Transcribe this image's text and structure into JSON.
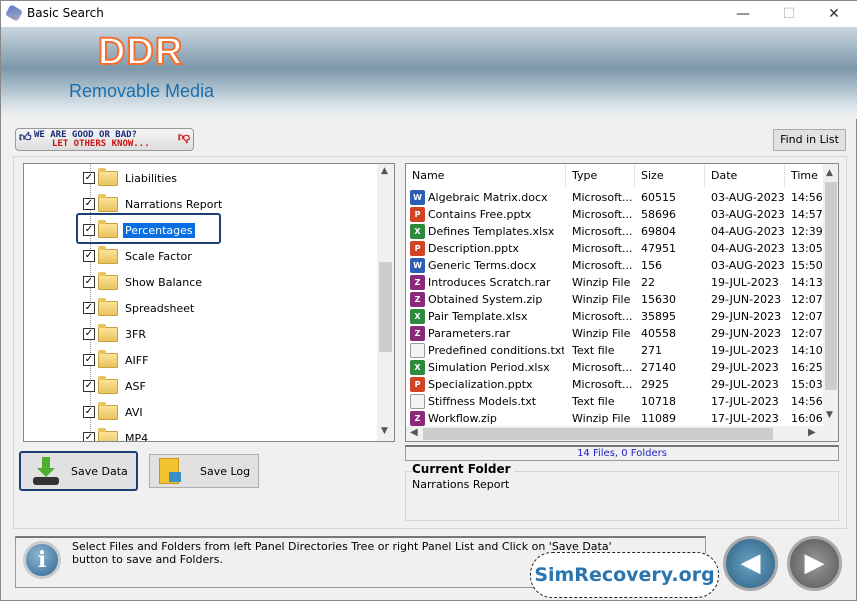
{
  "window": {
    "title": "Basic Search",
    "minimize": "—",
    "maximize": "☐",
    "close": "✕"
  },
  "banner": {
    "logo": "DDR",
    "subtitle": "Removable Media"
  },
  "feedback": {
    "line1": "WE ARE GOOD OR BAD?",
    "line2": "LET OTHERS KNOW..."
  },
  "toolbar": {
    "find_label": "Find in List"
  },
  "tree": {
    "items": [
      {
        "label": "Liabilities",
        "checked": true,
        "selected": false
      },
      {
        "label": "Narrations Report",
        "checked": true,
        "selected": false
      },
      {
        "label": "Percentages",
        "checked": true,
        "selected": true
      },
      {
        "label": "Scale Factor",
        "checked": true,
        "selected": false
      },
      {
        "label": "Show Balance",
        "checked": true,
        "selected": false
      },
      {
        "label": "Spreadsheet",
        "checked": true,
        "selected": false
      },
      {
        "label": "3FR",
        "checked": true,
        "selected": false
      },
      {
        "label": "AIFF",
        "checked": true,
        "selected": false
      },
      {
        "label": "ASF",
        "checked": true,
        "selected": false
      },
      {
        "label": "AVI",
        "checked": true,
        "selected": false
      },
      {
        "label": "MP4",
        "checked": true,
        "selected": false
      }
    ]
  },
  "list": {
    "columns": [
      "Name",
      "Type",
      "Size",
      "Date",
      "Time"
    ],
    "rows": [
      {
        "icon": "word",
        "name": "Algebraic Matrix.docx",
        "type": "Microsoft...",
        "size": "60515",
        "date": "03-AUG-2023",
        "time": "14:56"
      },
      {
        "icon": "powerpoint",
        "name": "Contains Free.pptx",
        "type": "Microsoft...",
        "size": "58696",
        "date": "03-AUG-2023",
        "time": "14:57"
      },
      {
        "icon": "excel",
        "name": "Defines Templates.xlsx",
        "type": "Microsoft...",
        "size": "69804",
        "date": "04-AUG-2023",
        "time": "12:39"
      },
      {
        "icon": "powerpoint",
        "name": "Description.pptx",
        "type": "Microsoft...",
        "size": "47951",
        "date": "04-AUG-2023",
        "time": "13:05"
      },
      {
        "icon": "word",
        "name": "Generic Terms.docx",
        "type": "Microsoft...",
        "size": "156",
        "date": "03-AUG-2023",
        "time": "15:50"
      },
      {
        "icon": "archive",
        "name": "Introduces Scratch.rar",
        "type": "Winzip File",
        "size": "22",
        "date": "19-JUL-2023",
        "time": "14:13"
      },
      {
        "icon": "archive",
        "name": "Obtained System.zip",
        "type": "Winzip File",
        "size": "15630",
        "date": "29-JUN-2023",
        "time": "12:07"
      },
      {
        "icon": "excel",
        "name": "Pair Template.xlsx",
        "type": "Microsoft...",
        "size": "35895",
        "date": "29-JUN-2023",
        "time": "12:07"
      },
      {
        "icon": "archive",
        "name": "Parameters.rar",
        "type": "Winzip File",
        "size": "40558",
        "date": "29-JUN-2023",
        "time": "12:07"
      },
      {
        "icon": "text",
        "name": "Predefined conditions.txt",
        "type": "Text file",
        "size": "271",
        "date": "19-JUL-2023",
        "time": "14:10"
      },
      {
        "icon": "excel",
        "name": "Simulation Period.xlsx",
        "type": "Microsoft...",
        "size": "27140",
        "date": "29-JUL-2023",
        "time": "16:25"
      },
      {
        "icon": "powerpoint",
        "name": "Specialization.pptx",
        "type": "Microsoft...",
        "size": "2925",
        "date": "29-JUL-2023",
        "time": "15:03"
      },
      {
        "icon": "text",
        "name": "Stiffness Models.txt",
        "type": "Text file",
        "size": "10718",
        "date": "17-JUL-2023",
        "time": "14:56"
      },
      {
        "icon": "archive",
        "name": "Workflow.zip",
        "type": "Winzip File",
        "size": "11089",
        "date": "17-JUL-2023",
        "time": "16:06"
      }
    ]
  },
  "status": {
    "summary": "14 Files, 0 Folders"
  },
  "current_folder": {
    "title": "Current Folder",
    "value": "Narrations Report"
  },
  "actions": {
    "save_data": "Save Data",
    "save_log": "Save Log"
  },
  "help": {
    "text": "Select Files and Folders from left Panel Directories Tree or right Panel List and Click on 'Save Data' button to save and Folders."
  },
  "watermark": "SimRecovery.org",
  "colors": {
    "selection": "#0a6ee0",
    "accent": "#1d3f73",
    "status_text": "#2222c8"
  }
}
